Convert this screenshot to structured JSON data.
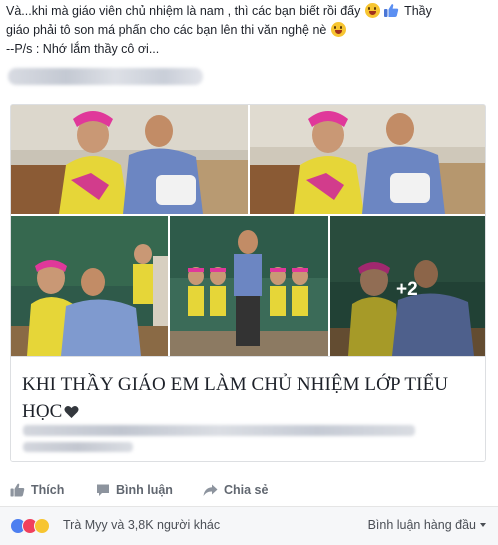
{
  "post": {
    "line1_a": "Và...khi mà giáo viên chủ nhiệm là nam , thì các bạn biết rồi đấy",
    "line1_b": "Thầy",
    "line2": "giáo phải tô son má phấn cho các bạn lên thi văn nghệ nè",
    "line3": "--P/s : Nhớ lắm thầy cô ơi..."
  },
  "gallery": {
    "more_count": "+2"
  },
  "link": {
    "title": "KHI THẦY GIÁO EM LÀM CHỦ NHIỆM LỚP TIỂU HỌC"
  },
  "actions": {
    "like": "Thích",
    "comment": "Bình luận",
    "share": "Chia sẻ"
  },
  "footer": {
    "reactions_text": "Trà Myy và 3,8K người khác",
    "sort_label": "Bình luận hàng đầu"
  },
  "colors": {
    "link_blue": "#4267b2",
    "text": "#1d2129",
    "muted": "#616770",
    "like_blue": "#4d7ff0",
    "love_red": "#f0405d"
  },
  "icons": [
    "haha-emoji-icon",
    "thumbs-up-icon",
    "heart-icon",
    "like-icon",
    "comment-icon",
    "share-icon",
    "caret-down-icon"
  ]
}
